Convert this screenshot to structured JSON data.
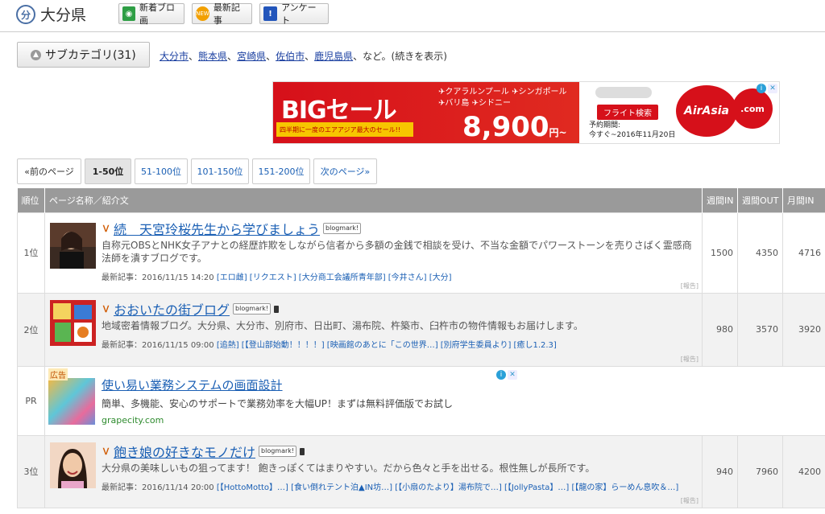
{
  "header": {
    "logo_text": "分",
    "title": "大分県",
    "buttons": [
      {
        "label": "新着ブロ画",
        "icon": "camera-icon"
      },
      {
        "label": "最新記事",
        "icon": "new-badge-icon",
        "icon_text": "NEW"
      },
      {
        "label": "アンケート",
        "icon": "exclamation-icon",
        "icon_text": "!"
      }
    ]
  },
  "subcategory": {
    "button_label": "サブカテゴリ(31)",
    "links": [
      "大分市",
      "熊本県",
      "宮崎県",
      "佐伯市",
      "鹿児島県"
    ],
    "separator": "、",
    "suffix": "、など。(続きを表示)"
  },
  "banner": {
    "headline": "BIGセール",
    "sub_text": "四半期に一度のエアアジア最大のセール!!",
    "destinations": [
      "クアラルンプール",
      "シンガポール",
      "バリ島",
      "シドニー"
    ],
    "price": "8,900",
    "price_unit": "円~",
    "flight_button": "フライト検索",
    "deadline_label": "予約期間:",
    "deadline": "今すぐ~2016年11月20日",
    "brand": "AirAsia",
    "brand_suffix": ".com",
    "brand_color": "#d6101a"
  },
  "pagination": {
    "prev": "«前のページ",
    "pages": [
      "1-50位",
      "51-100位",
      "101-150位",
      "151-200位"
    ],
    "current": "1-50位",
    "next": "次のページ»"
  },
  "table": {
    "headers": {
      "rank": "順位",
      "name": "ページ名称／紹介文",
      "week_in": "週間IN",
      "week_out": "週間OUT",
      "month_in": "月間IN"
    },
    "rows": [
      {
        "rank": "1位",
        "title": "続　天宮玲桜先生から学びましょう",
        "blogmark": "blogmark!",
        "description": "自称元OBSとNHK女子アナとの経歴詐欺をしながら信者から多額の金銭で相談を受け、不当な金額でパワーストーンを売りさばく霊感商法師を潰すブログです。",
        "latest_label": "最新記事：2016/11/15 14:20",
        "latest_tags": "[エロ雌] [リクエスト] [大分商工会議所青年部] [今井さん] [大分]",
        "report": "[報告]",
        "week_in": "1500",
        "week_out": "4350",
        "month_in": "4716"
      },
      {
        "rank": "2位",
        "title": "おおいたの街ブログ",
        "blogmark": "blogmark!",
        "description": "地域密着情報ブログ。大分県、大分市、別府市、日出町、湯布院、杵築市、臼杵市の物件情報もお届けします。",
        "latest_label": "最新記事：2016/11/15 09:00",
        "latest_tags": "[追熱] [【登山部始動！！！！] [映画館のあとに「この世界…] [別府学生委員より] [癒し1.2.3]",
        "report": "[報告]",
        "week_in": "980",
        "week_out": "3570",
        "month_in": "3920"
      },
      {
        "rank": "3位",
        "title": "飽き娘の好きなモノだけ",
        "blogmark": "blogmark!",
        "description": "大分県の美味しいもの狙ってます！ 飽きっぽくてはまりやすい。だから色々と手を出せる。根性無しが長所です。",
        "latest_label": "最新記事：2016/11/14 20:00",
        "latest_tags": "[【HottoMotto】…] [食い倒れテント泊▲IN坊…] [【小扇のたより】湯布院で…] [【JollyPasta】…] [【龍の家】らーめん息吹＆…]",
        "report": "[報告]",
        "week_in": "940",
        "week_out": "7960",
        "month_in": "4200"
      }
    ],
    "pr": {
      "rank": "PR",
      "tag": "広告",
      "title": "使い易い業務システムの画面設計",
      "description": "簡単、多機能、安心のサポートで業務効率を大幅UP！まずは無料評価版でお試し",
      "url": "grapecity.com"
    }
  }
}
